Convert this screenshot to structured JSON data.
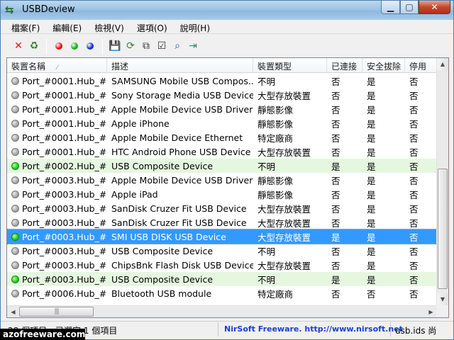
{
  "window": {
    "title": "USBDeview"
  },
  "menu": [
    "檔案(F)",
    "編輯(E)",
    "檢視(V)",
    "選項(O)",
    "說明(H)"
  ],
  "toolbar": {
    "buttons": [
      {
        "name": "delete-icon",
        "glyph": "✕",
        "color": "#d41c1c"
      },
      {
        "name": "recycle-icon",
        "glyph": "♻",
        "color": "#2f7f2f"
      },
      {
        "name": "red-dot-icon",
        "color": "#e01010"
      },
      {
        "name": "green-dot-icon",
        "color": "#10b010"
      },
      {
        "name": "blue-dot-icon",
        "color": "#1030d0"
      },
      {
        "name": "save-icon",
        "glyph": "💾",
        "color": "#1a1a1a"
      },
      {
        "name": "refresh-icon",
        "glyph": "⟳",
        "color": "#2c8a2c"
      },
      {
        "name": "copy-icon",
        "glyph": "⧉",
        "color": "#333"
      },
      {
        "name": "properties-icon",
        "glyph": "☑",
        "color": "#333"
      },
      {
        "name": "find-icon",
        "glyph": "⌕",
        "color": "#2050b0"
      },
      {
        "name": "exit-icon",
        "glyph": "⇥",
        "color": "#2a8a6a"
      }
    ]
  },
  "columns": [
    "裝置名稱",
    "描述",
    "裝置類型",
    "已連接",
    "安全拔除",
    "停用"
  ],
  "rows": [
    {
      "name": "Port_#0001.Hub_#...",
      "desc": "SAMSUNG Mobile USB Compos...",
      "type": "不明",
      "conn": "否",
      "safe": "是",
      "dis": "否",
      "state": "gray"
    },
    {
      "name": "Port_#0001.Hub_#...",
      "desc": "Sony Storage Media USB Device",
      "type": "大型存放裝置",
      "conn": "否",
      "safe": "是",
      "dis": "否",
      "state": "gray"
    },
    {
      "name": "Port_#0001.Hub_#...",
      "desc": "Apple Mobile Device USB Driver",
      "type": "靜態影像",
      "conn": "否",
      "safe": "是",
      "dis": "否",
      "state": "gray"
    },
    {
      "name": "Port_#0001.Hub_#...",
      "desc": "Apple iPhone",
      "type": "靜態影像",
      "conn": "否",
      "safe": "是",
      "dis": "否",
      "state": "gray"
    },
    {
      "name": "Port_#0001.Hub_#...",
      "desc": "Apple Mobile Device Ethernet",
      "type": "特定廠商",
      "conn": "否",
      "safe": "是",
      "dis": "否",
      "state": "gray"
    },
    {
      "name": "Port_#0001.Hub_#...",
      "desc": "HTC Android Phone USB Device",
      "type": "大型存放裝置",
      "conn": "否",
      "safe": "是",
      "dis": "否",
      "state": "gray"
    },
    {
      "name": "Port_#0002.Hub_#...",
      "desc": "USB Composite Device",
      "type": "不明",
      "conn": "是",
      "safe": "是",
      "dis": "否",
      "state": "green"
    },
    {
      "name": "Port_#0003.Hub_#...",
      "desc": "Apple Mobile Device USB Driver",
      "type": "靜態影像",
      "conn": "否",
      "safe": "是",
      "dis": "否",
      "state": "gray"
    },
    {
      "name": "Port_#0003.Hub_#...",
      "desc": "Apple iPad",
      "type": "靜態影像",
      "conn": "否",
      "safe": "是",
      "dis": "否",
      "state": "gray"
    },
    {
      "name": "Port_#0003.Hub_#...",
      "desc": "SanDisk Cruzer Fit USB Device",
      "type": "大型存放裝置",
      "conn": "否",
      "safe": "是",
      "dis": "否",
      "state": "gray"
    },
    {
      "name": "Port_#0003.Hub_#...",
      "desc": "SanDisk Cruzer Fit USB Device",
      "type": "大型存放裝置",
      "conn": "否",
      "safe": "是",
      "dis": "否",
      "state": "gray"
    },
    {
      "name": "Port_#0003.Hub_#...",
      "desc": "SMI USB DISK USB Device",
      "type": "大型存放裝置",
      "conn": "是",
      "safe": "是",
      "dis": "否",
      "state": "selected"
    },
    {
      "name": "Port_#0003.Hub_#...",
      "desc": "USB Composite Device",
      "type": "不明",
      "conn": "否",
      "safe": "是",
      "dis": "否",
      "state": "gray"
    },
    {
      "name": "Port_#0003.Hub_#...",
      "desc": "ChipsBnk Flash Disk USB Device",
      "type": "大型存放裝置",
      "conn": "否",
      "safe": "是",
      "dis": "否",
      "state": "gray"
    },
    {
      "name": "Port_#0003.Hub_#...",
      "desc": "USB Composite Device",
      "type": "不明",
      "conn": "是",
      "safe": "是",
      "dis": "否",
      "state": "green"
    },
    {
      "name": "Port_#0006.Hub_#...",
      "desc": "Bluetooth USB module",
      "type": "特定廠商",
      "conn": "否",
      "safe": "否",
      "dis": "否",
      "state": "gray"
    }
  ],
  "status": {
    "items": "28 個項目，已選定 1 個項目",
    "nirsoft": "NirSoft Freeware.  http://www.nirsoft.net",
    "right": "usb.ids 尚"
  },
  "watermark": "azofreeware.com"
}
